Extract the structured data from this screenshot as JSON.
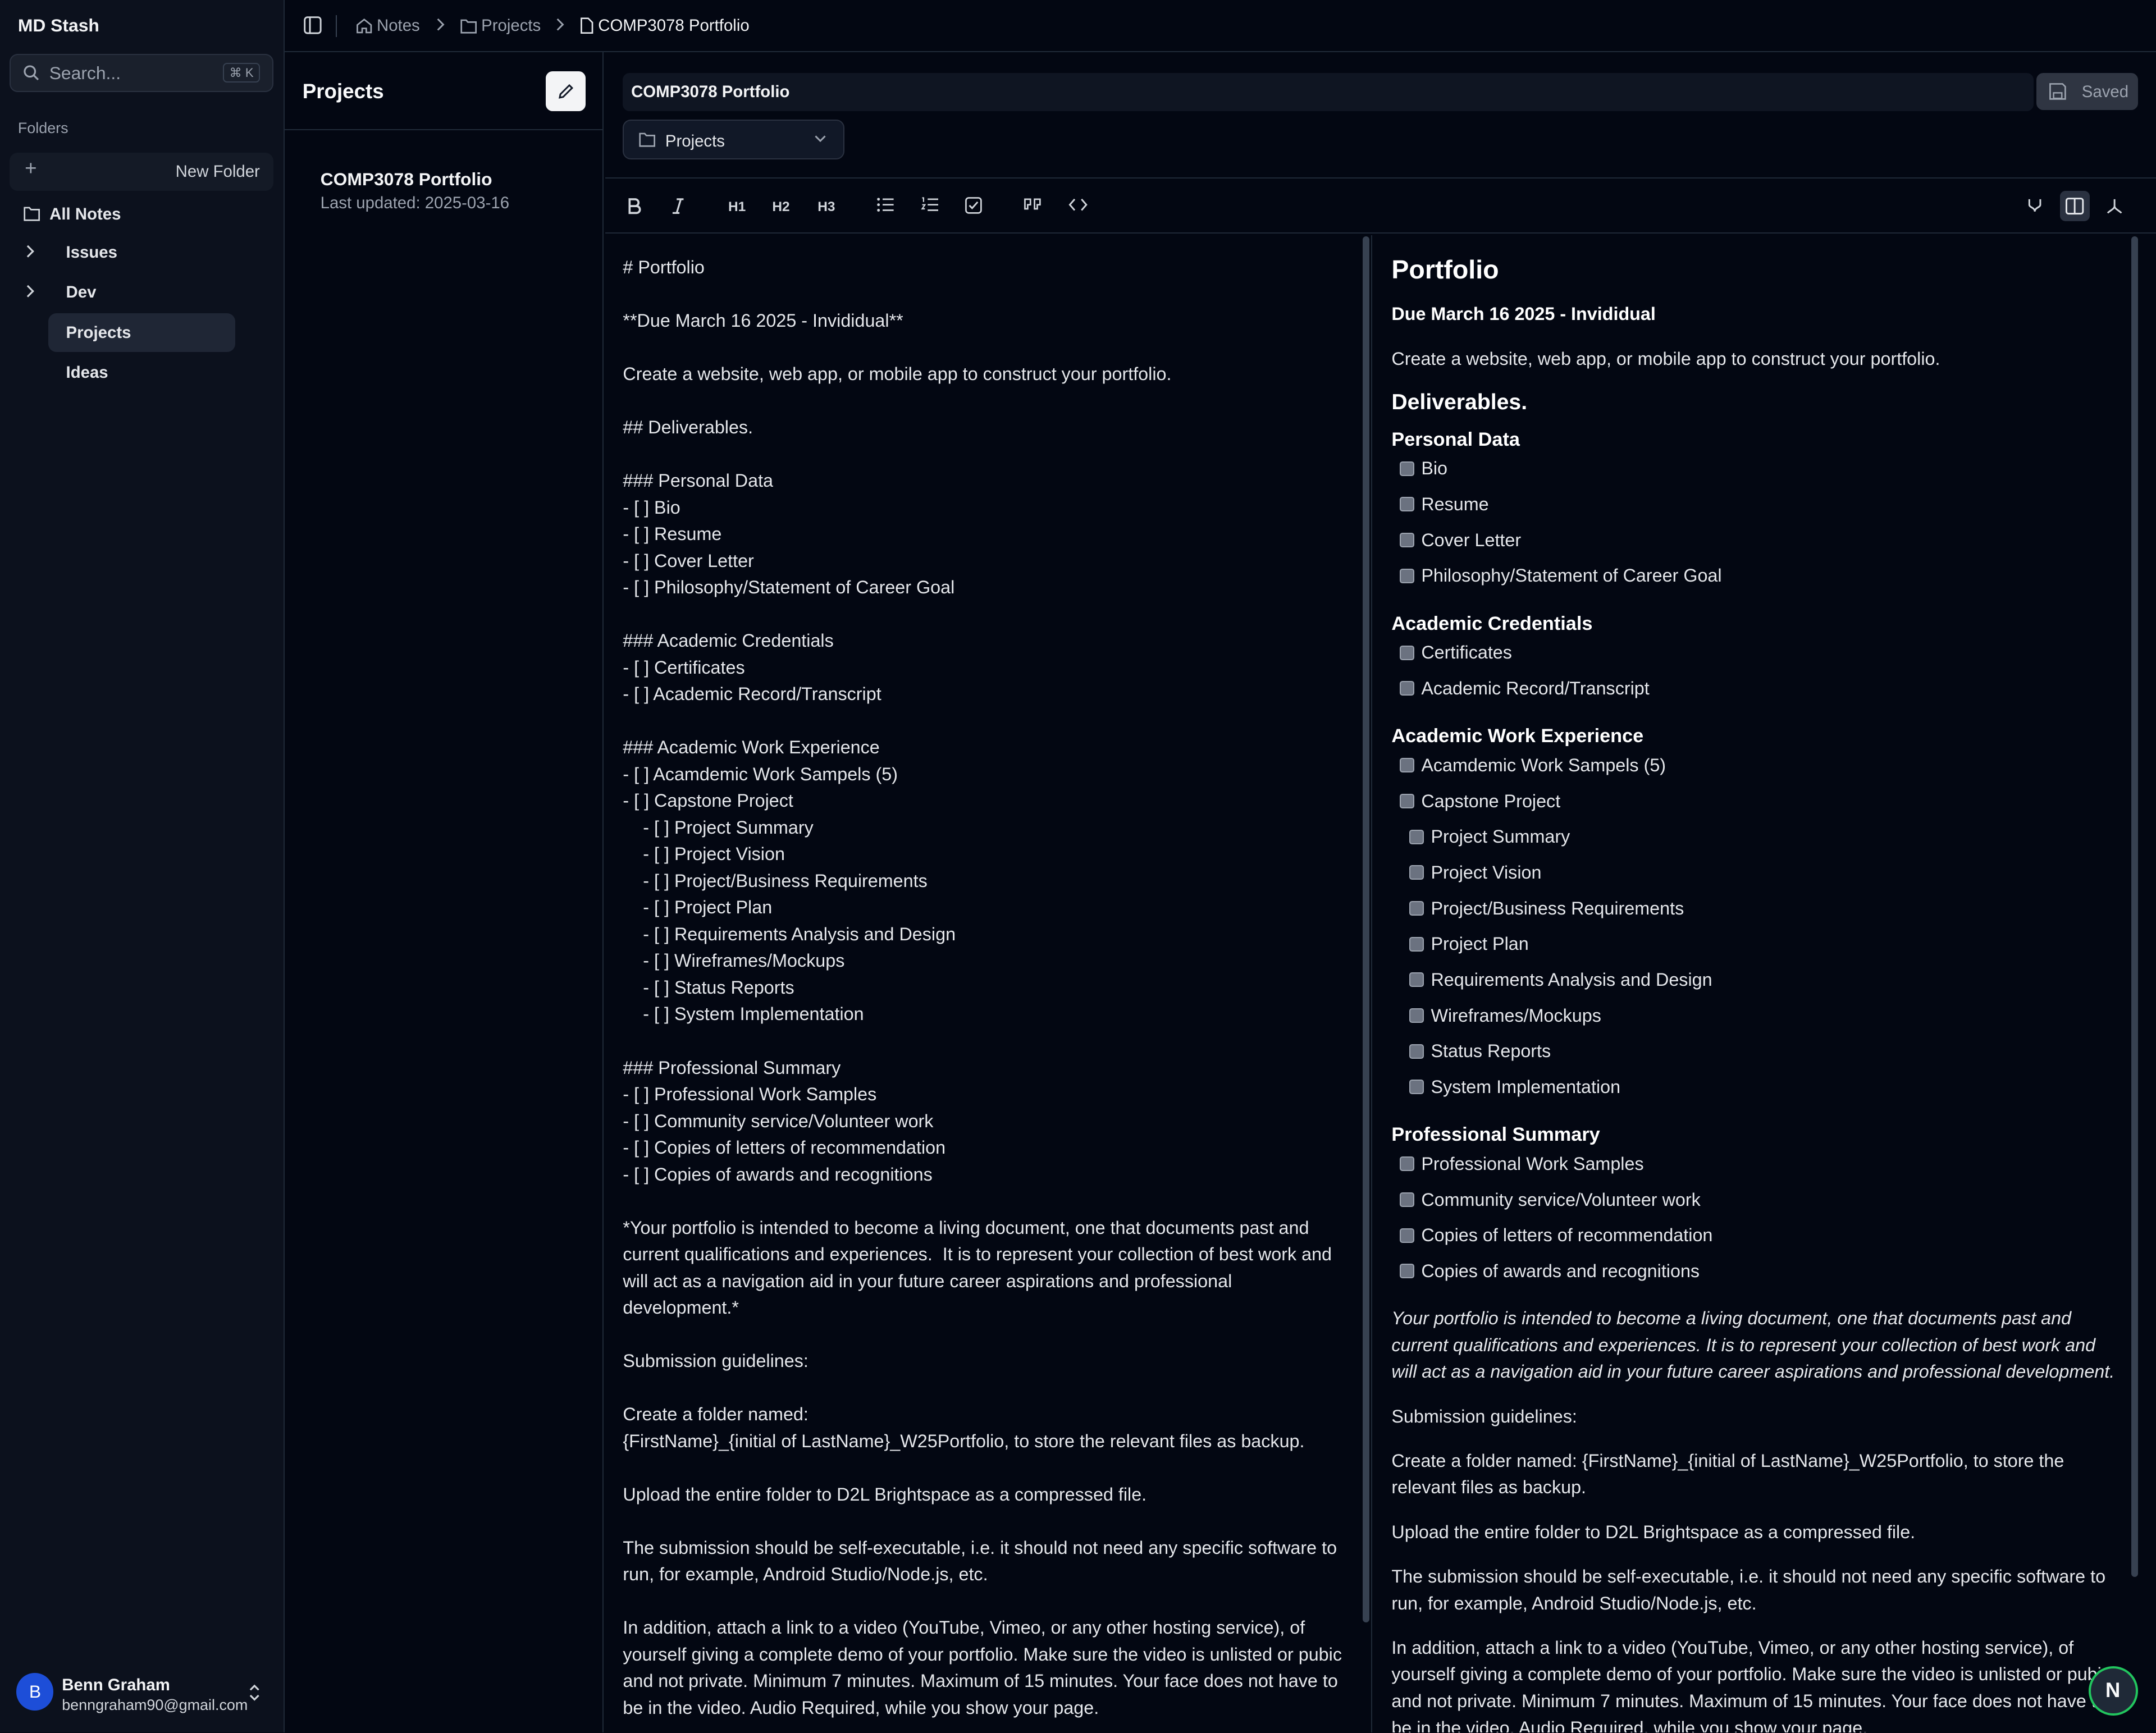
{
  "app": {
    "brand": "MD  Stash"
  },
  "search": {
    "placeholder": "Search...",
    "shortcut": "⌘ K"
  },
  "sidebar": {
    "folders_label": "Folders",
    "new_folder": "New Folder",
    "items": [
      {
        "label": "All Notes"
      },
      {
        "label": "Issues"
      },
      {
        "label": "Dev"
      },
      {
        "label": "Projects"
      },
      {
        "label": "Ideas"
      }
    ]
  },
  "user": {
    "initial": "B",
    "name": "Benn Graham",
    "email": "benngraham90@gmail.com"
  },
  "breadcrumb": {
    "items": [
      "Notes",
      "Projects",
      "COMP3078 Portfolio"
    ]
  },
  "notes_panel": {
    "title": "Projects",
    "note": {
      "title": "COMP3078 Portfolio",
      "updated": "Last updated: 2025-03-16"
    }
  },
  "editor": {
    "title": "COMP3078 Portfolio",
    "saved_label": "Saved",
    "folder": "Projects",
    "toolbar": {
      "h1": "H1",
      "h2": "H2",
      "h3": "H3"
    },
    "markdown": "# Portfolio\n\n**Due March 16 2025 - Invididual**\n\nCreate a website, web app, or mobile app to construct your portfolio.\n\n## Deliverables.\n\n### Personal Data\n- [ ] Bio\n- [ ] Resume\n- [ ] Cover Letter\n- [ ] Philosophy/Statement of Career Goal\n\n### Academic Credentials\n- [ ] Certificates\n- [ ] Academic Record/Transcript\n\n### Academic Work Experience\n- [ ] Acamdemic Work Sampels (5)\n- [ ] Capstone Project\n    - [ ] Project Summary\n    - [ ] Project Vision\n    - [ ] Project/Business Requirements\n    - [ ] Project Plan\n    - [ ] Requirements Analysis and Design\n    - [ ] Wireframes/Mockups\n    - [ ] Status Reports\n    - [ ] System Implementation\n\n### Professional Summary\n- [ ] Professional Work Samples\n- [ ] Community service/Volunteer work\n- [ ] Copies of letters of recommendation\n- [ ] Copies of awards and recognitions\n\n*Your portfolio is intended to become a living document, one that documents past and current qualifications and experiences.  It is to represent your collection of best work and will act as a navigation aid in your future career aspirations and professional development.*\n\nSubmission guidelines:\n\nCreate a folder named:\n{FirstName}_{initial of LastName}_W25Portfolio, to store the relevant files as backup.\n\nUpload the entire folder to D2L Brightspace as a compressed file.\n\nThe submission should be self-executable, i.e. it should not need any specific software to run, for example, Android Studio/Node.js, etc.\n\nIn addition, attach a link to a video (YouTube, Vimeo, or any other hosting service), of yourself giving a complete demo of your portfolio. Make sure the video is unlisted or pubic and not private. Minimum 7 minutes. Maximum of 15 minutes. Your face does not have to be in the video. Audio Required, while you show your page."
  },
  "preview": {
    "h1": "Portfolio",
    "due": "Due March 16 2025 - Invididual",
    "intro": "Create a website, web app, or mobile app to construct your portfolio.",
    "h2": "Deliverables.",
    "sections": [
      {
        "title": "Personal Data",
        "items": [
          {
            "text": "Bio",
            "sub": false
          },
          {
            "text": "Resume",
            "sub": false
          },
          {
            "text": "Cover Letter",
            "sub": false
          },
          {
            "text": "Philosophy/Statement of Career Goal",
            "sub": false
          }
        ]
      },
      {
        "title": "Academic Credentials",
        "items": [
          {
            "text": "Certificates",
            "sub": false
          },
          {
            "text": "Academic Record/Transcript",
            "sub": false
          }
        ]
      },
      {
        "title": "Academic Work Experience",
        "items": [
          {
            "text": "Acamdemic Work Sampels (5)",
            "sub": false
          },
          {
            "text": "Capstone Project",
            "sub": false
          },
          {
            "text": "Project Summary",
            "sub": true
          },
          {
            "text": "Project Vision",
            "sub": true
          },
          {
            "text": "Project/Business Requirements",
            "sub": true
          },
          {
            "text": "Project Plan",
            "sub": true
          },
          {
            "text": "Requirements Analysis and Design",
            "sub": true
          },
          {
            "text": "Wireframes/Mockups",
            "sub": true
          },
          {
            "text": "Status Reports",
            "sub": true
          },
          {
            "text": "System Implementation",
            "sub": true
          }
        ]
      },
      {
        "title": "Professional Summary",
        "items": [
          {
            "text": "Professional Work Samples",
            "sub": false
          },
          {
            "text": "Community service/Volunteer work",
            "sub": false
          },
          {
            "text": "Copies of letters of recommendation",
            "sub": false
          },
          {
            "text": "Copies of awards and recognitions",
            "sub": false
          }
        ]
      }
    ],
    "italic": "Your portfolio is intended to become a living document, one that documents past and current qualifications and experiences. It is to represent your collection of best work and will act as a navigation aid in your future career aspirations and professional development.",
    "paragraphs": [
      "Submission guidelines:",
      "Create a folder named: {FirstName}_{initial of LastName}_W25Portfolio, to store the relevant files as backup.",
      "Upload the entire folder to D2L Brightspace as a compressed file.",
      "The submission should be self-executable, i.e. it should not need any specific software to run, for example, Android Studio/Node.js, etc.",
      "In addition, attach a link to a video (YouTube, Vimeo, or any other hosting service), of yourself giving a complete demo of your portfolio. Make sure the video is unlisted or pubic and not private. Minimum 7 minutes. Maximum of 15 minutes. Your face does not have to be in the video. Audio Required, while you show your page."
    ]
  },
  "floating": {
    "label": "N"
  },
  "colors": {
    "background": "#030712",
    "sidebar": "#0c111d",
    "accent": "#1d4ed8",
    "ring": "#22c55e"
  }
}
